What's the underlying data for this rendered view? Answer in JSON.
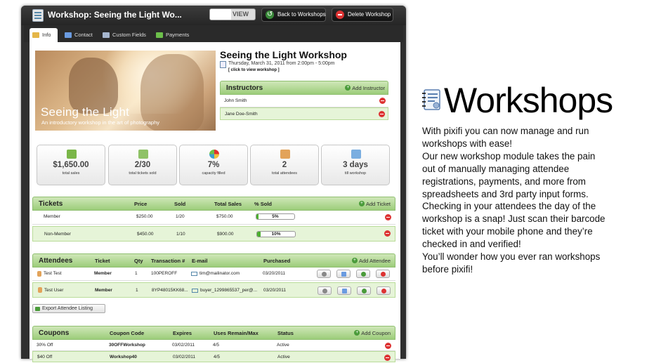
{
  "window": {
    "title": "Workshop: Seeing the Light Wo...",
    "view_label": "VIEW",
    "back_button": "Back to Workshops",
    "delete_button": "Delete Workshop"
  },
  "tabs": [
    {
      "label": "Info",
      "active": true,
      "icon": "pencil-icon"
    },
    {
      "label": "Contact",
      "icon": "contact-icon"
    },
    {
      "label": "Custom Fields",
      "icon": "fields-icon"
    },
    {
      "label": "Payments",
      "icon": "money-icon"
    }
  ],
  "hero": {
    "title": "Seeing the Light",
    "subtitle": "An introductory workshop in the art of photography"
  },
  "workshop": {
    "title": "Seeing the Light Workshop",
    "date": "Thursday, March 31, 2011 from 2:00pm - 5:00pm",
    "link": "[ click to view workshop ]"
  },
  "instructors": {
    "title": "Instructors",
    "add_label": "Add Instructor",
    "items": [
      "John Smith",
      "Jane Doe-Smith"
    ]
  },
  "stats": [
    {
      "value": "$1,650.00",
      "label": "total sales",
      "icon": "cash-icon"
    },
    {
      "value": "2/30",
      "label": "total tickets sold",
      "icon": "ticket-icon"
    },
    {
      "value": "7%",
      "label": "capacity filled",
      "icon": "pie-icon"
    },
    {
      "value": "2",
      "label": "total attendees",
      "icon": "people-icon"
    },
    {
      "value": "3 days",
      "label": "till workshop",
      "icon": "calendar-icon"
    }
  ],
  "tickets": {
    "title": "Tickets",
    "add_label": "Add Ticket",
    "columns": {
      "price": "Price",
      "sold": "Sold",
      "total_sales": "Total Sales",
      "pct_sold": "% Sold"
    },
    "rows": [
      {
        "name": "Member",
        "price": "$250.00",
        "sold": "1/20",
        "total": "$750.00",
        "pct": "5%",
        "pct_value": 5
      },
      {
        "name": "Non-Member",
        "price": "$450.00",
        "sold": "1/10",
        "total": "$900.00",
        "pct": "10%",
        "pct_value": 10
      }
    ]
  },
  "attendees": {
    "title": "Attendees",
    "add_label": "Add Attendee",
    "columns": {
      "ticket": "Ticket",
      "qty": "Qty",
      "transaction": "Transaction #",
      "email": "E-mail",
      "purchased": "Purchased"
    },
    "rows": [
      {
        "name": "Test Test",
        "ticket": "Member",
        "qty": "1",
        "transaction": "100PEROFF",
        "email": "tim@mailinator.com",
        "purchased": "03/20/2011"
      },
      {
        "name": "Test User",
        "ticket": "Member",
        "qty": "1",
        "transaction": "8YP48015KK68...",
        "email": "buyer_1299865537_per@...",
        "purchased": "03/20/2011"
      }
    ],
    "export_label": "Export Attendee Listing"
  },
  "coupons": {
    "title": "Coupons",
    "add_label": "Add Coupon",
    "columns": {
      "code": "Coupon Code",
      "expires": "Expires",
      "uses": "Uses Remain/Max",
      "status": "Status"
    },
    "rows": [
      {
        "name": "30% Off",
        "code": "30OFFWorkshop",
        "expires": "03/02/2011",
        "uses": "4/5",
        "status": "Active"
      },
      {
        "name": "$40 Off",
        "code": "Workshop40",
        "expires": "03/02/2011",
        "uses": "4/5",
        "status": "Active"
      }
    ]
  },
  "promo": {
    "title": "Workshops",
    "lines": [
      "With pixifi you can now manage and run",
      "workshops with ease!",
      "Our new workshop module takes the pain",
      "out of manually managing attendee",
      "registrations, payments, and more from",
      "spreadsheets and 3rd party input forms.",
      "Checking in your attendees the day of the",
      "workshop is a snap! Just scan their barcode",
      "ticket with your mobile phone and they’re",
      "checked in and verified!",
      "You’ll wonder how you ever ran workshops",
      "before pixifi!"
    ]
  }
}
